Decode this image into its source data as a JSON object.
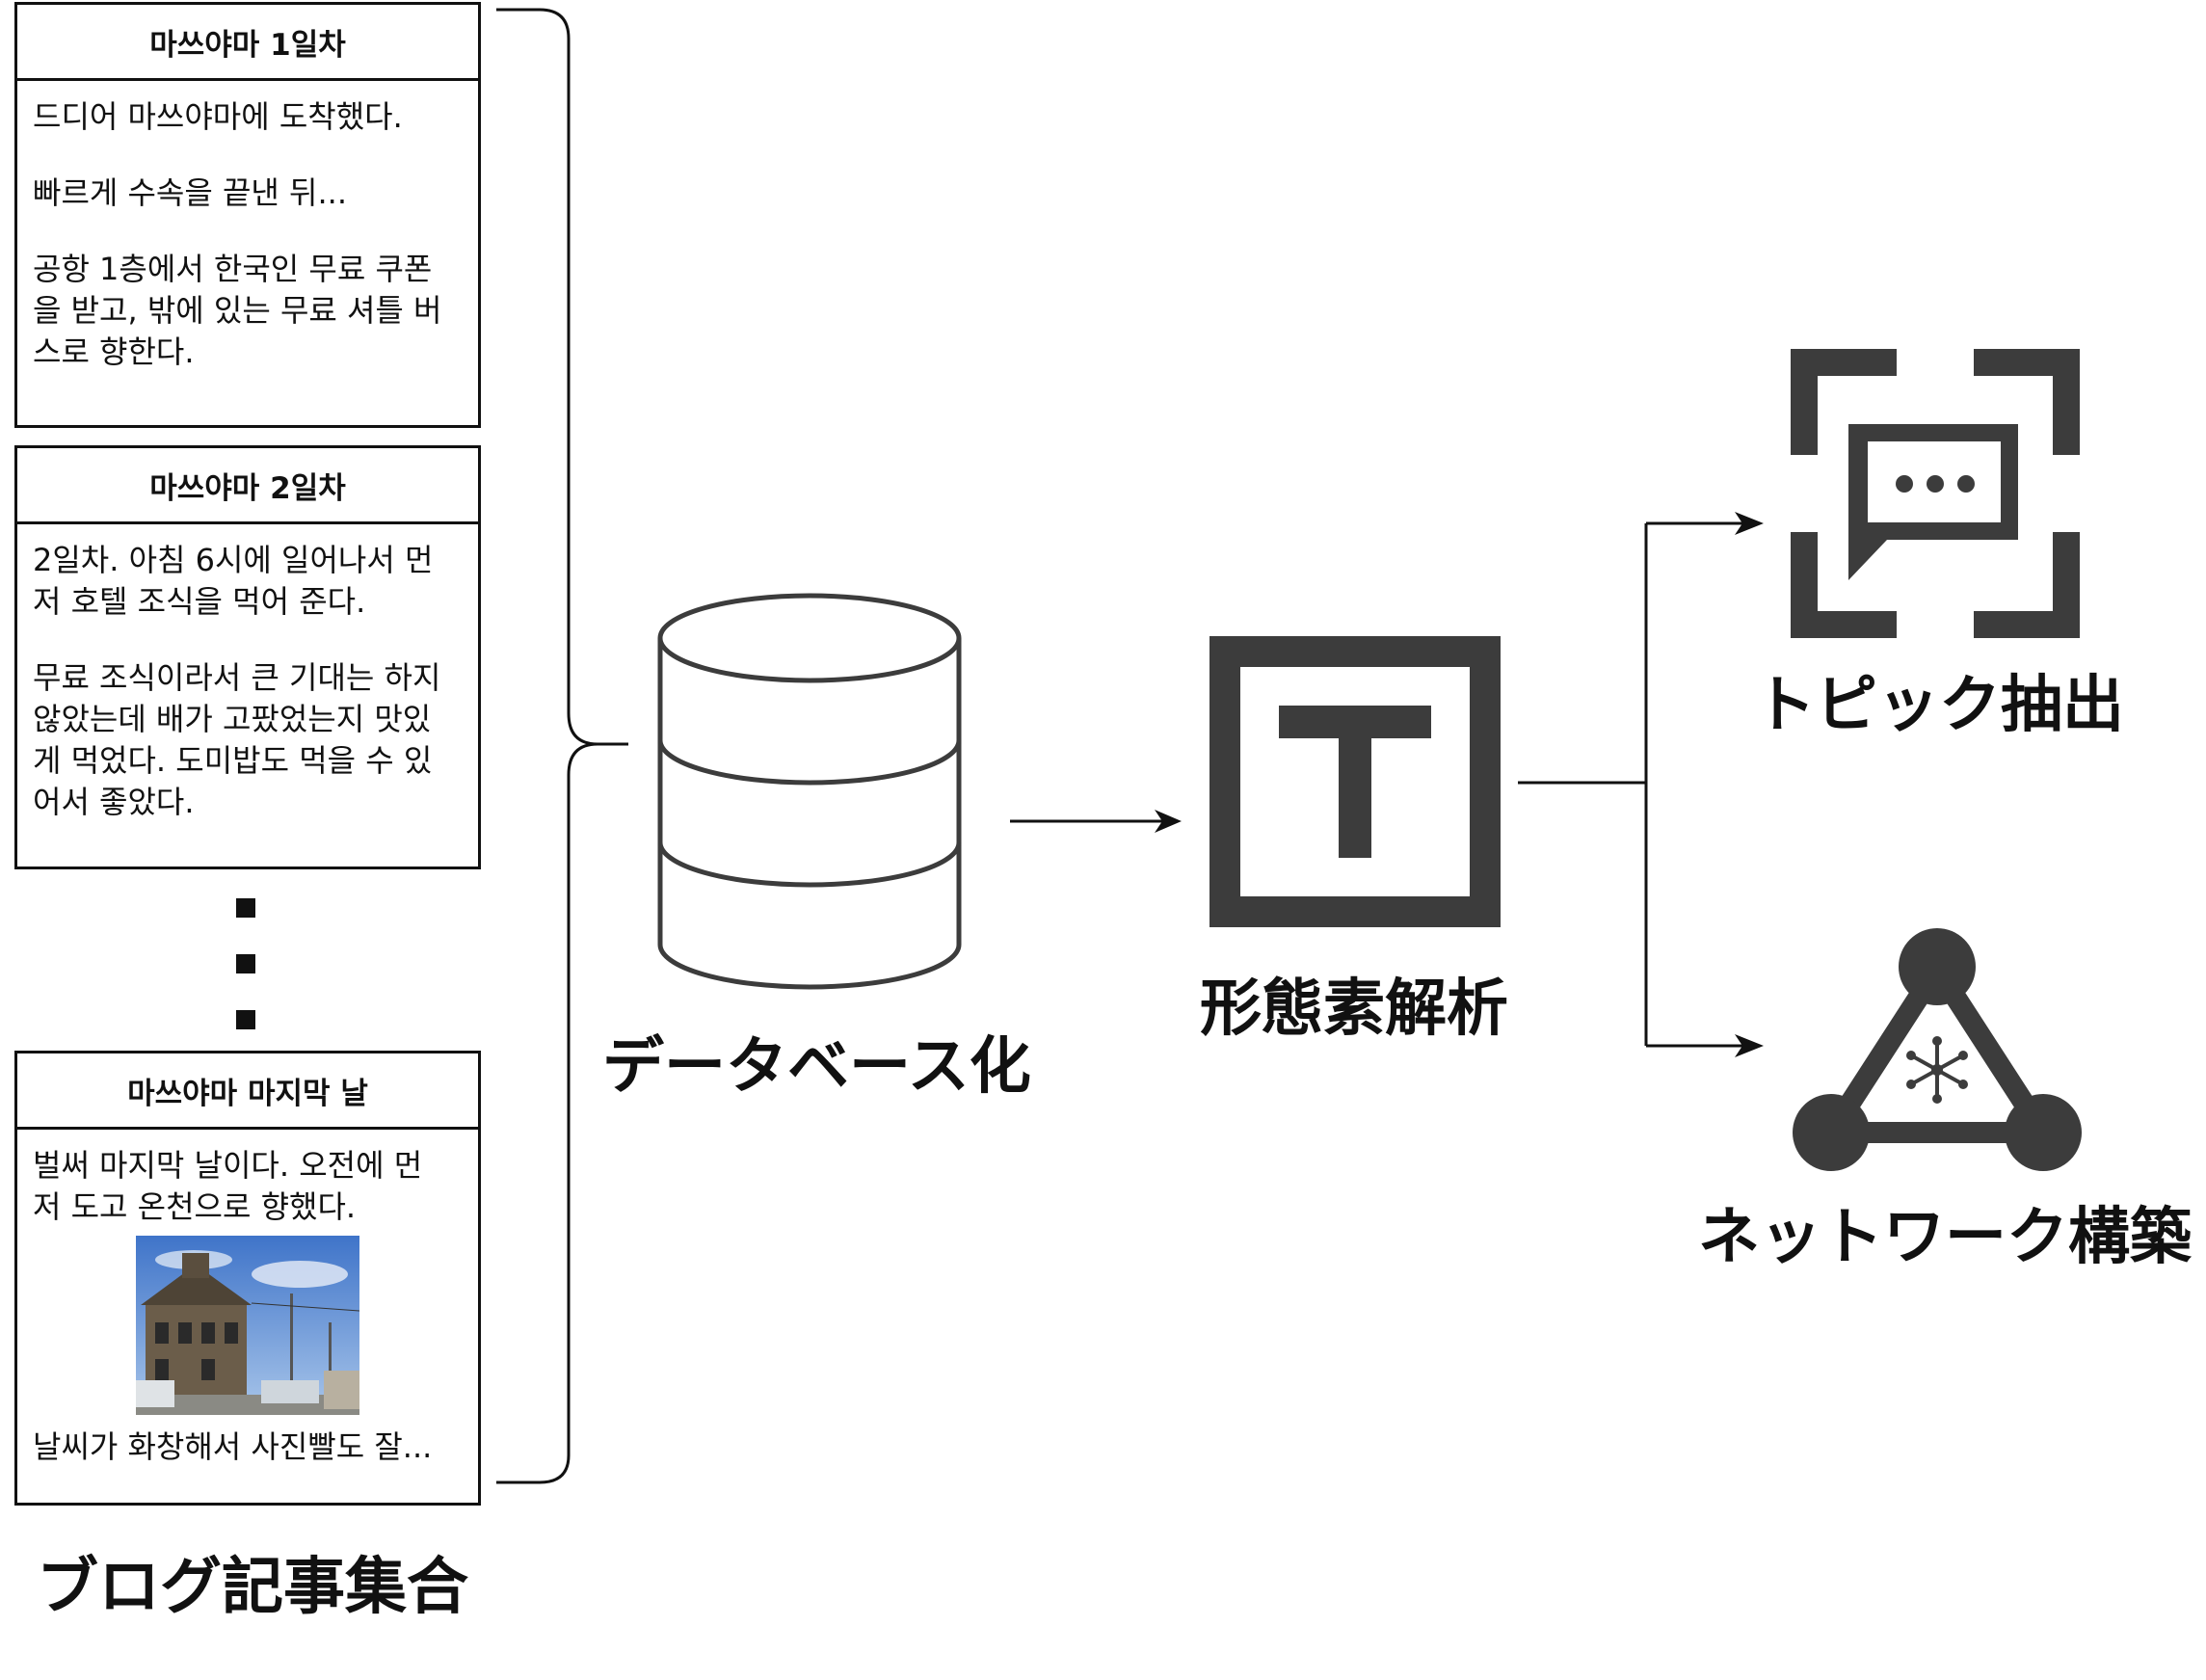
{
  "blog_cards": [
    {
      "title": "마쓰야마 1일차",
      "paragraphs": [
        "드디어 마쓰야마에 도착했다.",
        "빠르게 수속을 끝낸 뒤...",
        "공항 1층에서 한국인 무료 쿠폰\n을 받고, 밖에 있는 무료 셔틀 버\n스로 향한다."
      ]
    },
    {
      "title": "마쓰야마 2일차",
      "paragraphs": [
        "2일차. 아침 6시에 일어나서 먼\n저 호텔 조식을 먹어 준다.",
        "무료 조식이라서 큰 기대는 하지\n않았는데 배가 고팠었는지 맛있\n게 먹었다. 도미밥도 먹을 수 있\n어서 좋았다."
      ]
    },
    {
      "title": "마쓰야마 마지막 날",
      "paragraphs": [
        "벌써 마지막 날이다. 오전에 먼\n저 도고 온천으로 향했다.",
        "날씨가 화창해서 사진빨도 잘..."
      ]
    }
  ],
  "labels": {
    "blog_collection": "ブログ記事集合",
    "database": "データベース化",
    "morph": "形態素解析",
    "topic": "トピック抽出",
    "network": "ネットワーク構築"
  },
  "icons": {
    "database": "database-icon",
    "morph": "text-box-icon",
    "topic": "chat-bubble-scan-icon",
    "network": "network-triangle-icon"
  },
  "colors": {
    "icon_dark": "#3c3c3c",
    "line": "#111111"
  }
}
